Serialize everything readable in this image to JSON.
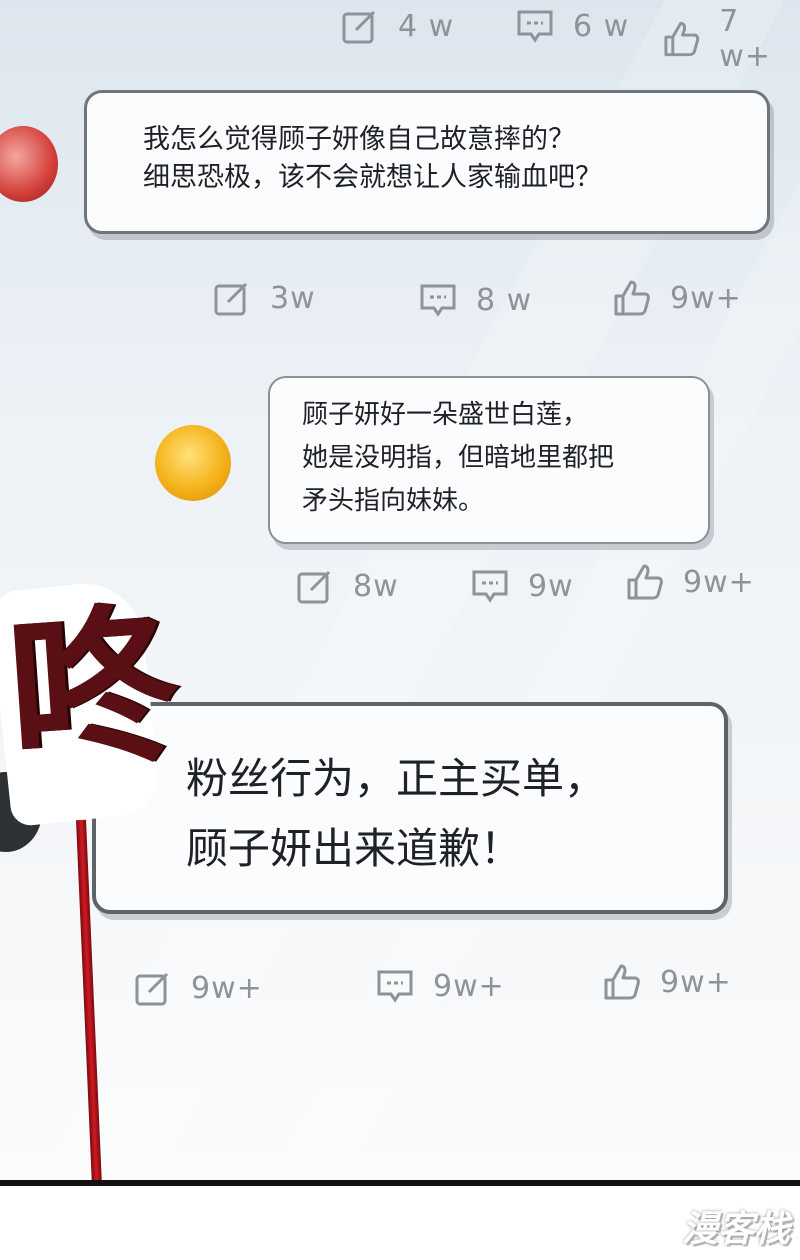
{
  "rows": [
    {
      "share": "4 w",
      "comment": "6 w",
      "like": "7 w+"
    },
    {
      "share": "3w",
      "comment": "8 w",
      "like": "9w+"
    },
    {
      "share": "8w",
      "comment": "9w",
      "like": "9w+"
    },
    {
      "share": "9w+",
      "comment": "9w+",
      "like": "9w+"
    }
  ],
  "comments": [
    {
      "lines": [
        "我怎么觉得顾子妍像自己故意摔的？",
        "细思恐极，该不会就想让人家输血吧？"
      ]
    },
    {
      "lines": [
        "顾子妍好一朵盛世白莲，",
        "她是没明指，但暗地里都把",
        "矛头指向妹妹。"
      ]
    },
    {
      "lines": [
        "粉丝行为，正主买单，",
        "顾子妍出来道歉！"
      ]
    }
  ],
  "sfx": {
    "text": "咚"
  },
  "watermark": {
    "text": "漫客栈"
  },
  "icons": {
    "share": "share-edit-icon",
    "comment": "comment-icon",
    "like": "thumbs-up-icon"
  }
}
